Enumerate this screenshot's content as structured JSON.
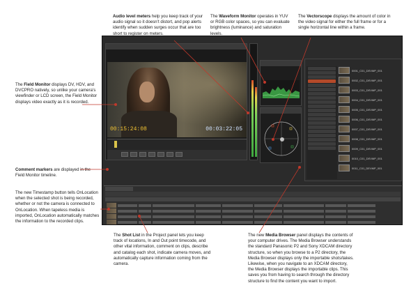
{
  "callouts": {
    "audio_level": {
      "lead": "Audio level meters",
      "text": " help you keep track of your audio signal so it doesn’t distort, and pop alerts identify when sudden surges occur that are too short to register on meters."
    },
    "waveform": {
      "pre": "The ",
      "lead": "Waveform Monitor",
      "text": " operates in YUV or RGB color spaces, so you can evaluate bright­ness (luminance) and saturation levels."
    },
    "vectorscope": {
      "pre": "The ",
      "lead": "Vectorscope",
      "text": " displays the amount of color in the video signal for either the full frame or for a single horizontal line within a frame."
    },
    "field_monitor": {
      "pre": "The ",
      "lead": "Field Monitor",
      "text": " displays DV, HDV, and DVCPRO natively, so unlike your camera’s viewfinder or LCD screen, the Field Monitor displays video exactly as it is recorded."
    },
    "comment_markers": {
      "lead": "Comment markers",
      "text": " are displayed in the Field Monitor timeline."
    },
    "timestamp": {
      "text": "The new Timestamp button tells OnLocation when the selected shot is being recorded, whether or not the camera is connected to OnLocation. When tapeless media is imported, OnLocation automatically matches the information to the recorded clips."
    },
    "shot_list": {
      "pre": "The ",
      "lead": "Shot List",
      "text": " in the Project panel lets you keep track of locations, In and Out point timecode, and other vital information, comment on clips, describe and catalog each shot, indicate camera moves, and automatically capture information coming from the camera."
    },
    "media_browser": {
      "pre": "The new ",
      "lead": "Media Browser",
      "text": " panel displays the contents of your computer drives. The Media Browser understands the standard Panasonic P2 and Sony XDCAM directory structure, so when you browse to a P2 directory, the Media Browser displays only the importable shots/takes. Likewise, when you navigate to an XDCAM directory, the Media Browser displays the importable clips. This saves you from having to search through the directory structure to find the content you want to import."
    }
  },
  "app": {
    "field_monitor": {
      "timecode_left": "00:15:24:08",
      "timecode_right": "00:03:22:05"
    },
    "media_browser": {
      "clips": [
        "0001_C01_DEVMP_001",
        "0002_C01_DEVMP_001",
        "0003_C01_DEVMP_001",
        "0004_C01_DEVMP_001",
        "0005_C01_DEVMP_001",
        "0006_C01_DEVMP_001",
        "0007_C01_DEVMP_001",
        "0008_C01_DEVMP_001",
        "0009_C01_DEVMP_001",
        "0010_C01_DEVMP_001",
        "0011_C01_DEVMP_001"
      ]
    }
  }
}
